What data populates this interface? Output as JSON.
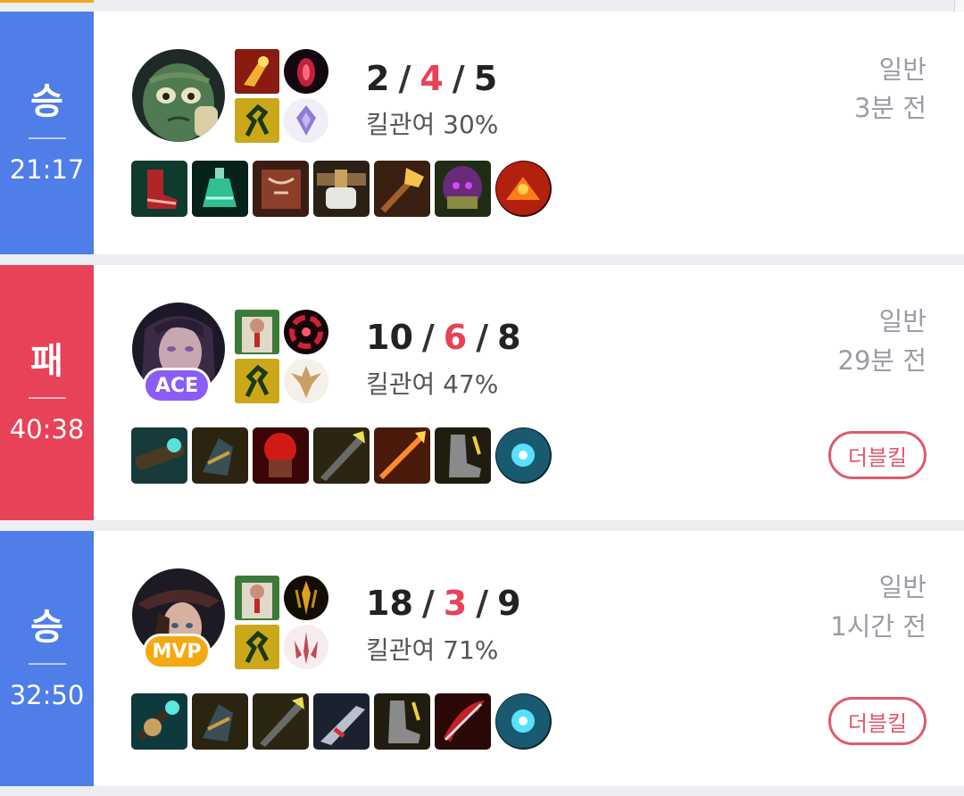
{
  "matches": [
    {
      "result": "승",
      "result_type": "win",
      "duration": "21:17",
      "champion_icon": "mummy-champion-portrait",
      "badge": "",
      "kills": "2",
      "deaths": "4",
      "assists": "5",
      "kill_participation": "킬관여 30%",
      "mode": "일반",
      "time_ago": "3분 전",
      "multikill": ""
    },
    {
      "result": "패",
      "result_type": "loss",
      "duration": "40:38",
      "champion_icon": "purple-haired-champion-portrait",
      "badge": "ACE",
      "kills": "10",
      "deaths": "6",
      "assists": "8",
      "kill_participation": "킬관여 47%",
      "mode": "일반",
      "time_ago": "29분 전",
      "multikill": "더블킬"
    },
    {
      "result": "승",
      "result_type": "win",
      "duration": "32:50",
      "champion_icon": "hat-wearing-champion-portrait",
      "badge": "MVP",
      "kills": "18",
      "deaths": "3",
      "assists": "9",
      "kill_participation": "킬관여 71%",
      "mode": "일반",
      "time_ago": "1시간 전",
      "multikill": "더블킬"
    }
  ],
  "separator": "/",
  "colors": {
    "win": "#4f7ee8",
    "loss": "#e84258",
    "ace_badge": "#8b5cf6",
    "mvp_badge": "#f5a80f",
    "multikill": "#e05a6b",
    "muted_text": "#9a9ea6"
  }
}
